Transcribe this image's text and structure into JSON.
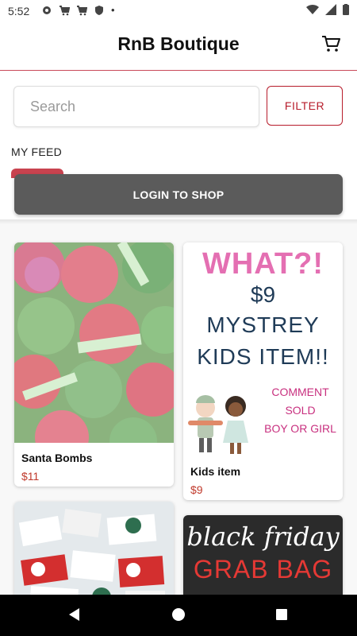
{
  "status_bar": {
    "time": "5:52",
    "dot": "•"
  },
  "app_bar": {
    "title": "RnB Boutique"
  },
  "search": {
    "placeholder": "Search",
    "value": ""
  },
  "filter": {
    "label": "FILTER"
  },
  "feed": {
    "label": "MY FEED"
  },
  "login": {
    "label": "LOGIN TO SHOP"
  },
  "products": [
    {
      "name": "Santa Bombs",
      "price": "$11"
    },
    {
      "name": "Kids item",
      "price": "$9",
      "image_text": [
        "WHAT?!",
        "$9",
        "MYSTREY",
        "KIDS ITEM!!",
        "COMMENT",
        "SOLD",
        "BOY OR GIRL"
      ]
    },
    {
      "name": "",
      "price": ""
    },
    {
      "name": "",
      "price": "",
      "image_text": [
        "black friday",
        "GRAB BAG"
      ]
    }
  ],
  "colors": {
    "accent": "#b71c2b",
    "price": "#c0392b",
    "login_bg": "#5b5b5b",
    "tab": "#c8434f"
  }
}
